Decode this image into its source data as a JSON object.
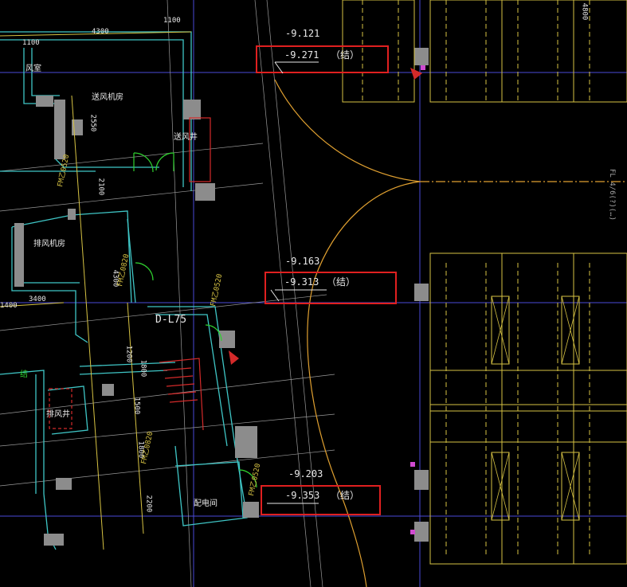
{
  "drawing": {
    "colors": {
      "background": "#000000",
      "wall": "#3fc6c6",
      "column": "#8c8c8c",
      "grid": "#4a4ad8",
      "yellow": "#d6c243",
      "red": "#d42a2a",
      "highlight": "#e02020",
      "text": "#e8e8e8",
      "green": "#2fd02f"
    },
    "elevations": [
      {
        "top": "-9.121",
        "bottom": "-9.271",
        "suffix": "（结）"
      },
      {
        "top": "-9.163",
        "bottom": "-9.313",
        "suffix": "（结）"
      },
      {
        "top": "-9.203",
        "bottom": "-9.353",
        "suffix": "（结）"
      }
    ],
    "dimensions": [
      "4300",
      "1100",
      "2550",
      "2100",
      "4300",
      "3400",
      "1400",
      "1200",
      "1800",
      "1500",
      "1800",
      "2200"
    ],
    "dimensions_extra": [
      "1100",
      "4800"
    ],
    "rooms": [
      "风室",
      "送风机房",
      "送风井",
      "排风机房",
      "排风井",
      "配电间",
      "结"
    ],
    "doors": [
      "FM乙0520",
      "FM乙0820",
      "FM乙0520",
      "FM乙0820",
      "FM乙0520",
      "FM乙0520"
    ],
    "label_dl": "D-L75",
    "side_note": "FL 4/6(?)(…)"
  }
}
